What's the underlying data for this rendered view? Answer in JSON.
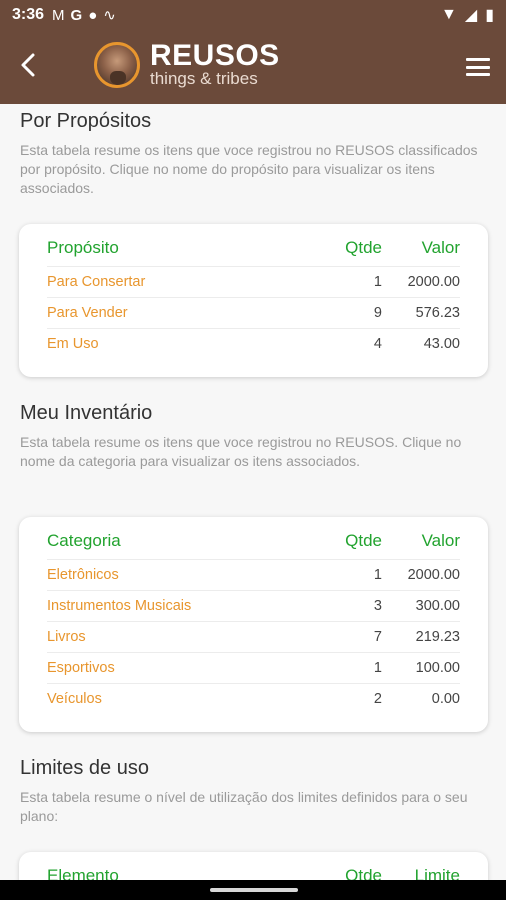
{
  "status": {
    "time": "3:36",
    "icons": [
      "gmail-icon",
      "google-icon",
      "circle-icon",
      "signal-wave-icon"
    ]
  },
  "appbar": {
    "brand": "REUSOS",
    "tagline": "things & tribes"
  },
  "sections": [
    {
      "title": "Por Propósitos",
      "desc": "Esta tabela resume os itens que voce registrou no REUSOS classificados por propósito. Clique no nome do propósito para visualizar os itens associados.",
      "headers": [
        "Propósito",
        "Qtde",
        "Valor"
      ],
      "rows": [
        {
          "name": "Para Consertar",
          "qty": "1",
          "value": "2000.00"
        },
        {
          "name": "Para Vender",
          "qty": "9",
          "value": "576.23"
        },
        {
          "name": "Em Uso",
          "qty": "4",
          "value": "43.00"
        }
      ]
    },
    {
      "title": "Meu Inventário",
      "desc": "Esta tabela resume os itens que voce registrou no REUSOS. Clique no nome da categoria para visualizar os itens associados.",
      "headers": [
        "Categoria",
        "Qtde",
        "Valor"
      ],
      "rows": [
        {
          "name": "Eletrônicos",
          "qty": "1",
          "value": "2000.00"
        },
        {
          "name": "Instrumentos Musicais",
          "qty": "3",
          "value": "300.00"
        },
        {
          "name": "Livros",
          "qty": "7",
          "value": "219.23"
        },
        {
          "name": "Esportivos",
          "qty": "1",
          "value": "100.00"
        },
        {
          "name": "Veículos",
          "qty": "2",
          "value": "0.00"
        }
      ]
    },
    {
      "title": "Limites de uso",
      "desc": "Esta tabela resume o nível de utilização dos limites definidos para o seu plano:",
      "headers": [
        "Elemento",
        "Qtde",
        "Limite"
      ],
      "rows": []
    }
  ],
  "colors": {
    "appbar": "#6b4a3a",
    "accent_green": "#22a32f",
    "accent_orange": "#e8962e"
  }
}
